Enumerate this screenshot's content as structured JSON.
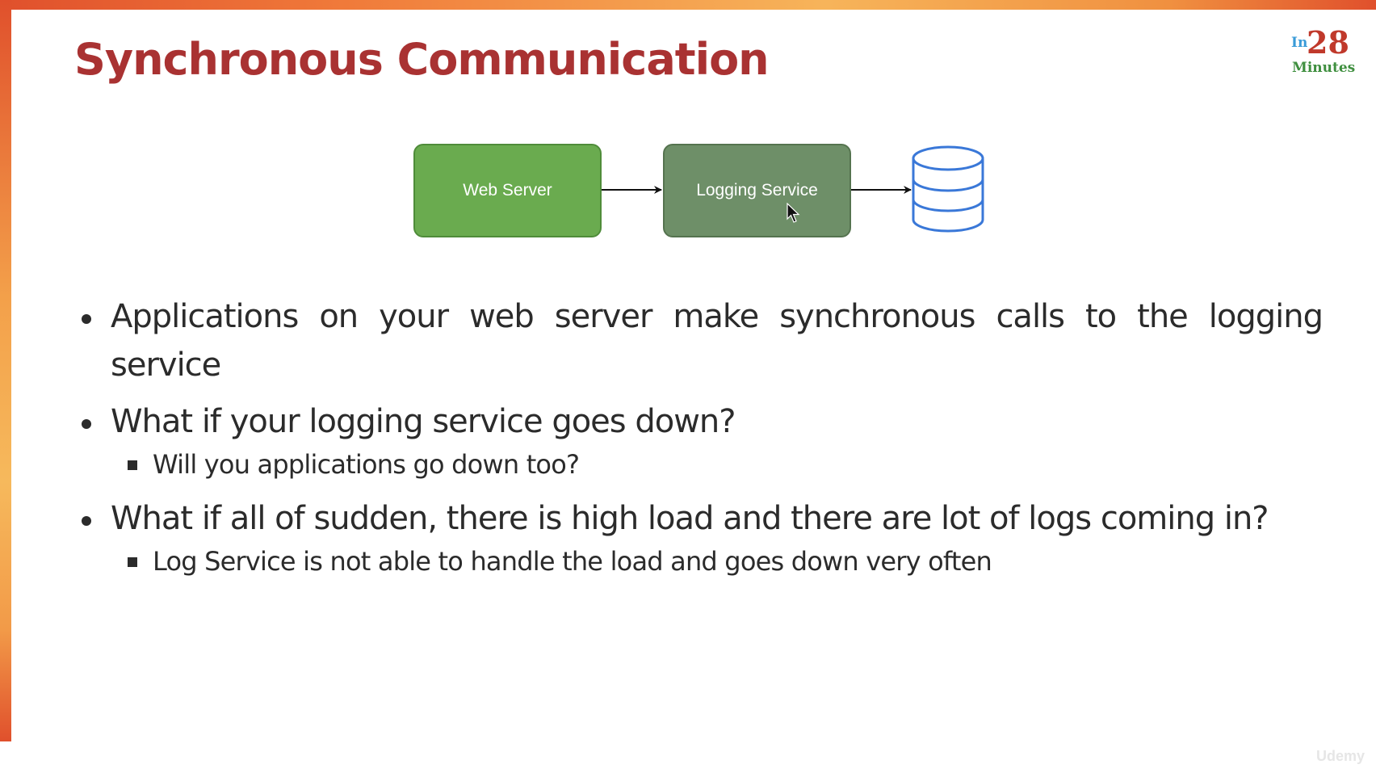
{
  "slide": {
    "title": "Synchronous Communication",
    "logo": {
      "in": "In",
      "number": "28",
      "minutes": "Minutes"
    },
    "diagram": {
      "web_server_label": "Web Server",
      "logging_service_label": "Logging Service",
      "database_icon": "database-icon",
      "colors": {
        "web_server": "#6aab4f",
        "logging_service": "#6e8f68",
        "database_stroke": "#3a78d8"
      }
    },
    "bullets": [
      {
        "text": "Applications on your web server make synchronous calls to the logging service",
        "sub": []
      },
      {
        "text": "What if your logging service goes down?",
        "sub": [
          "Will you applications go down too?"
        ]
      },
      {
        "text": "What if all of sudden, there is high load and there are lot of logs coming in?",
        "sub": [
          "Log Service is not able to handle the load and goes down very often"
        ]
      }
    ],
    "watermark": "Udemy"
  }
}
